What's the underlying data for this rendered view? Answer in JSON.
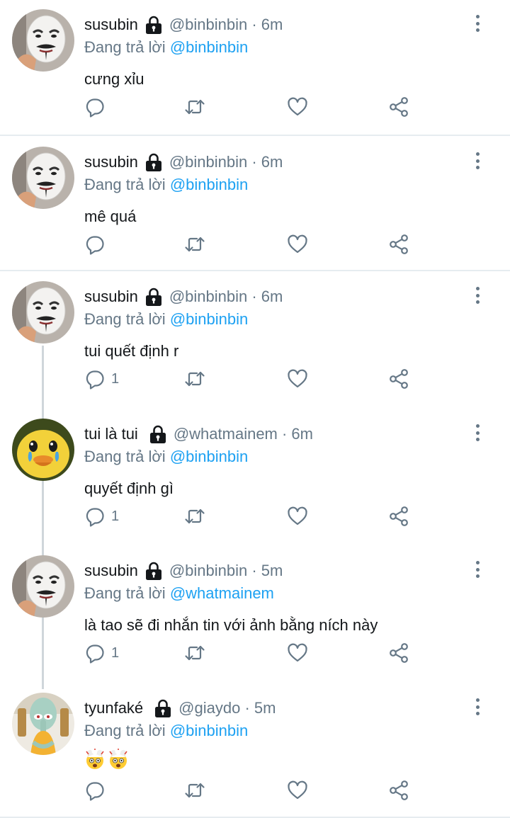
{
  "labels": {
    "replying_to": "Đang trả lời"
  },
  "colors": {
    "link": "#1da1f2",
    "muted": "#657786",
    "thread_line": "#cfd6db",
    "divider": "#e6ecf0"
  },
  "tweets": [
    {
      "name": "susubin",
      "handle": "@binbinbin · 6m",
      "mention": "@binbinbin",
      "text": "cưng xỉu",
      "reply_count": "",
      "avatar": "guy-fawkes-mask"
    },
    {
      "name": "susubin",
      "handle": "@binbinbin · 6m",
      "mention": "@binbinbin",
      "text": "mê quá",
      "reply_count": "",
      "avatar": "guy-fawkes-mask"
    },
    {
      "name": "susubin",
      "handle": "@binbinbin · 6m",
      "mention": "@binbinbin",
      "text": "tui quết định r",
      "reply_count": "1",
      "avatar": "guy-fawkes-mask"
    },
    {
      "name": "tui là tui",
      "handle": "@whatmainem · 6m",
      "mention": "@binbinbin",
      "text": "quyết định gì",
      "reply_count": "1",
      "avatar": "crying-duck"
    },
    {
      "name": "susubin",
      "handle": "@binbinbin · 5m",
      "mention": "@whatmainem",
      "text": "là tao sẽ đi nhắn tin với ảnh bằng ních này",
      "reply_count": "1",
      "avatar": "guy-fawkes-mask"
    },
    {
      "name": "tyunfaké",
      "handle": "@giaydo · 5m",
      "mention": "@binbinbin",
      "text": "🤯🤯",
      "reply_count": "",
      "avatar": "squidward"
    }
  ]
}
